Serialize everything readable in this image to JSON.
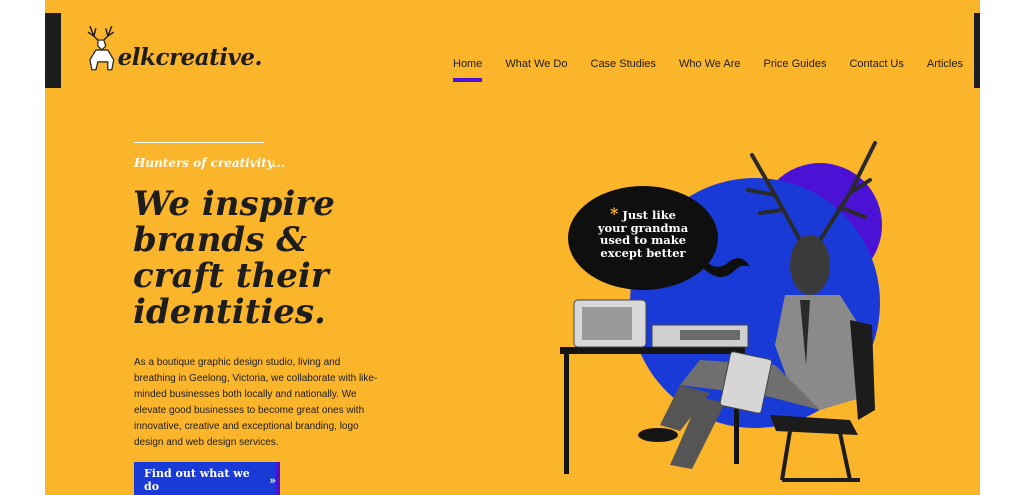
{
  "header": {
    "logo_text": "elkcreative."
  },
  "nav": {
    "items": [
      {
        "label": "Home",
        "active": true
      },
      {
        "label": "What We Do"
      },
      {
        "label": "Case Studies"
      },
      {
        "label": "Who We Are"
      },
      {
        "label": "Price Guides"
      },
      {
        "label": "Contact Us"
      },
      {
        "label": "Articles"
      }
    ]
  },
  "hero": {
    "tagline": "Hunters of creativity...",
    "headline": [
      "We inspire",
      "brands &",
      "craft their",
      "identities."
    ],
    "description": "As a boutique graphic design studio, living and breathing in Geelong, Victoria, we collaborate with like-minded businesses both locally and nationally. We elevate good businesses to become great ones with innovative, creative and exceptional branding, logo design and web design services.",
    "cta_label": "Find out what we do",
    "cta_chevron": "»"
  },
  "illustration": {
    "bubble_star": "*",
    "bubble_lines": [
      "Just like",
      "your grandma",
      "used to make",
      "except better"
    ]
  },
  "colors": {
    "background": "#fbb52b",
    "accent_purple": "#4b12d6",
    "accent_blue": "#1a3ad8",
    "text_dark": "#1d1d1d"
  }
}
